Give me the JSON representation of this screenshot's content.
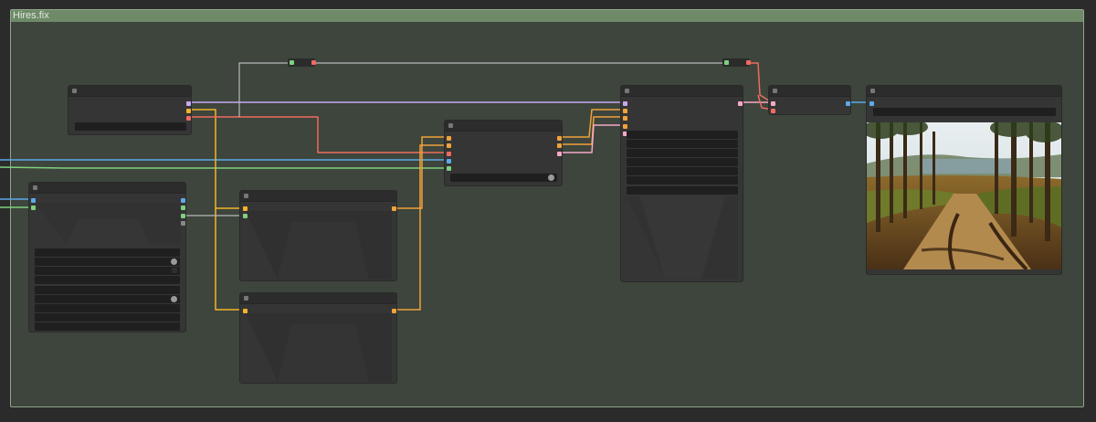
{
  "group": {
    "title": "Hires.fix",
    "color": "#6e8a69"
  },
  "colors": {
    "model": "#c7a8f0",
    "clip": "#f3b32a",
    "vae": "#ef6b5f",
    "latent": "#f7a8c8",
    "image": "#5da9e9",
    "conditioning": "#f0a23b",
    "int": "#7fd07f",
    "gray_wire": "#b9b9b9",
    "canvas_bg": "#3d453c"
  },
  "nodes": [
    {
      "id": "checkpoint-loader",
      "outputs": [
        "model",
        "clip",
        "vae"
      ]
    },
    {
      "id": "empty-latent",
      "inputs": [
        "image",
        "int"
      ],
      "outputs": [
        "image",
        "int",
        "int",
        "int"
      ]
    },
    {
      "id": "positive-prompt",
      "inputs": [
        "clip"
      ],
      "outputs": [
        "conditioning"
      ]
    },
    {
      "id": "negative-prompt",
      "inputs": [
        "clip"
      ],
      "outputs": [
        "conditioning"
      ]
    },
    {
      "id": "ksampler-1",
      "inputs": [
        "conditioning",
        "conditioning",
        "vae",
        "image",
        "int"
      ],
      "outputs": [
        "conditioning",
        "conditioning",
        "latent"
      ]
    },
    {
      "id": "ksampler-2",
      "inputs": [
        "model",
        "conditioning",
        "conditioning",
        "conditioning",
        "latent"
      ],
      "outputs": [
        "latent"
      ]
    },
    {
      "id": "vae-decode",
      "inputs": [
        "latent",
        "vae"
      ],
      "outputs": [
        "image"
      ]
    },
    {
      "id": "preview-image",
      "inputs": [
        "image"
      ]
    }
  ],
  "preview": {
    "icon": "forest-road-photo"
  }
}
